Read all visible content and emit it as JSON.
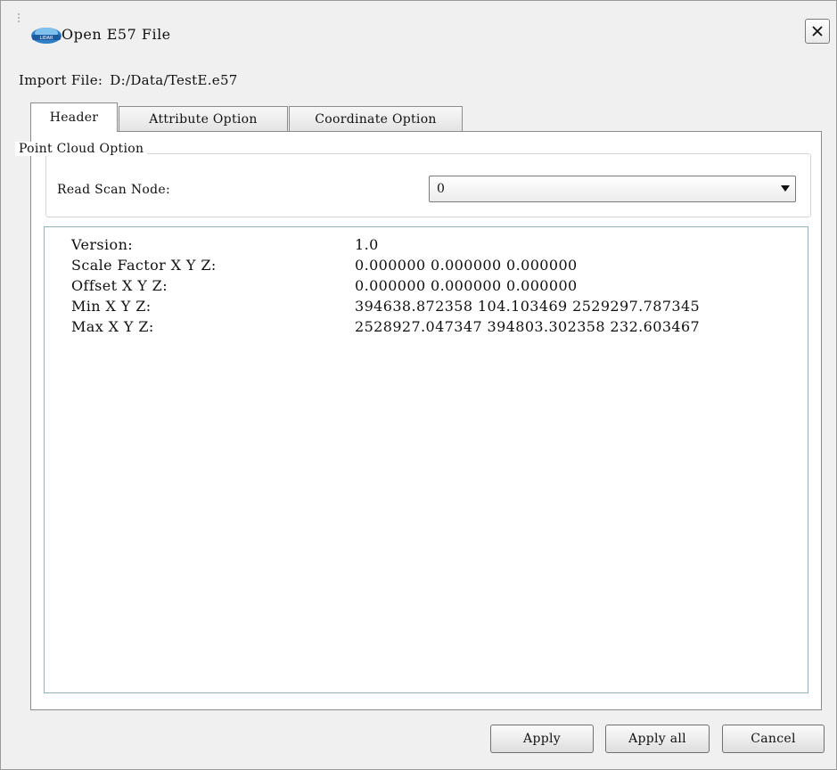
{
  "window": {
    "title": "Open E57 File",
    "close_icon": "close-icon",
    "app_icon": "lidar-app-icon"
  },
  "import": {
    "label": "Import File:",
    "path": "D:/Data/TestE.e57"
  },
  "tabs": [
    {
      "label": "Header",
      "active": true
    },
    {
      "label": "Attribute Option",
      "active": false
    },
    {
      "label": "Coordinate Option",
      "active": false
    }
  ],
  "point_cloud_option": {
    "group_title": "Point Cloud Option",
    "read_scan_node_label": "Read Scan Node:",
    "read_scan_node_value": "0"
  },
  "header_info": [
    {
      "key": "Version:",
      "value": "1.0"
    },
    {
      "key": "Scale Factor X Y Z:",
      "value": "0.000000 0.000000 0.000000"
    },
    {
      "key": "Offset X Y Z:",
      "value": "0.000000 0.000000 0.000000"
    },
    {
      "key": "Min X Y Z:",
      "value": "394638.872358 104.103469 2529297.787345"
    },
    {
      "key": "Max X Y Z:",
      "value": "2528927.047347 394803.302358 232.603467"
    }
  ],
  "buttons": {
    "apply": "Apply",
    "apply_all": "Apply all",
    "cancel": "Cancel"
  },
  "colors": {
    "dialog_bg": "#f0f0f0",
    "panel_bg": "#ffffff",
    "info_border": "#8fb3c4"
  }
}
